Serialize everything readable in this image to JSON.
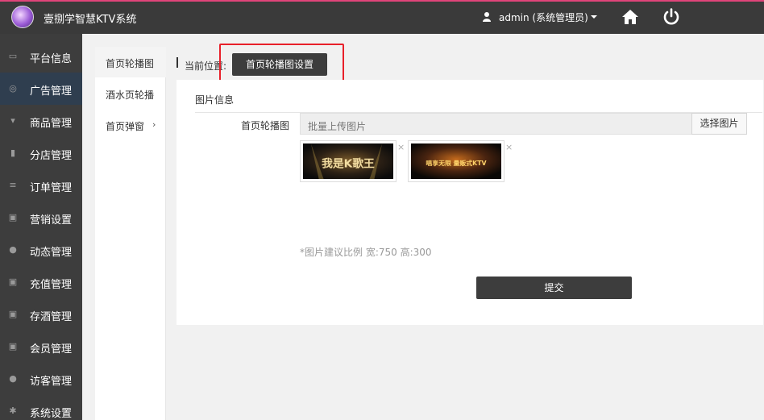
{
  "header": {
    "app_title": "壹捌学智慧KTV系统",
    "user_label": "admin (系统管理员)",
    "icons": [
      "user-icon",
      "home-icon",
      "power-icon"
    ]
  },
  "sidebar": {
    "items": [
      {
        "label": "平台信息",
        "icon": "keyboard-icon"
      },
      {
        "label": "广告管理",
        "icon": "lifebuoy-icon",
        "active": true
      },
      {
        "label": "商品管理",
        "icon": "cart-icon"
      },
      {
        "label": "分店管理",
        "icon": "building-icon"
      },
      {
        "label": "订单管理",
        "icon": "list-icon"
      },
      {
        "label": "营销设置",
        "icon": "gift-icon"
      },
      {
        "label": "动态管理",
        "icon": "user-icon"
      },
      {
        "label": "充值管理",
        "icon": "gift-icon"
      },
      {
        "label": "存酒管理",
        "icon": "gift-icon"
      },
      {
        "label": "会员管理",
        "icon": "gift-icon"
      },
      {
        "label": "访客管理",
        "icon": "user-icon"
      },
      {
        "label": "系统设置",
        "icon": "gear-icon"
      }
    ]
  },
  "subnav": {
    "items": [
      {
        "label": "首页轮播图",
        "active": true
      },
      {
        "label": "酒水页轮播"
      },
      {
        "label": "首页弹窗",
        "chevron": "›"
      }
    ]
  },
  "breadcrumb": {
    "label": "当前位置:",
    "current": "首页轮播图设置"
  },
  "panel": {
    "title": "图片信息",
    "field_label": "首页轮播图",
    "upload_placeholder": "批量上传图片",
    "upload_button": "选择图片",
    "thumbnails": [
      {
        "caption": "我是K歌王",
        "close": "×"
      },
      {
        "caption": "唱享无限 量贩式KTV",
        "close": "×"
      }
    ],
    "hint": "*图片建议比例 宽:750 高:300",
    "submit": "提交"
  },
  "colors": {
    "topbar": "#3a3a3a",
    "topbar_accent": "#e0447a",
    "sidebar": "#3d3d3d",
    "sidebar_active": "#2f3e4f",
    "highlight": "#e8202a"
  }
}
